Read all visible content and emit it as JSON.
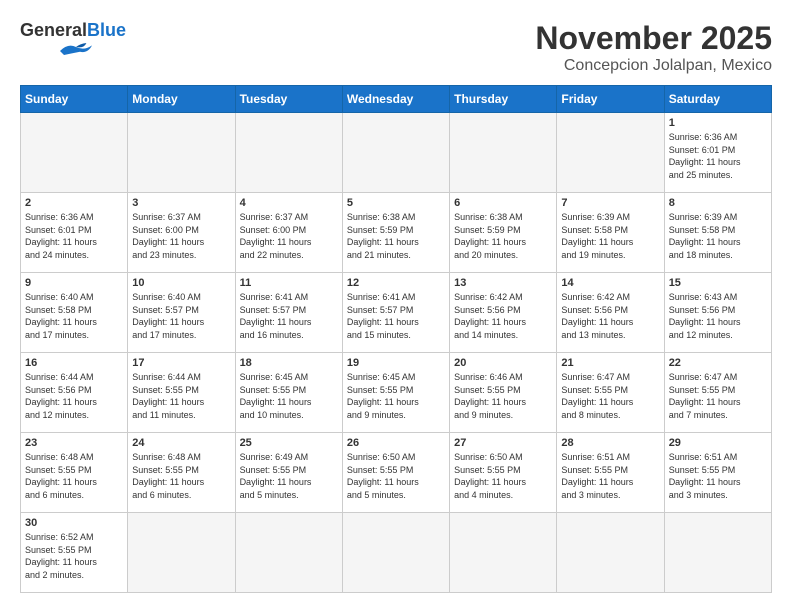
{
  "header": {
    "logo_general": "General",
    "logo_blue": "Blue",
    "month": "November 2025",
    "location": "Concepcion Jolalpan, Mexico"
  },
  "weekdays": [
    "Sunday",
    "Monday",
    "Tuesday",
    "Wednesday",
    "Thursday",
    "Friday",
    "Saturday"
  ],
  "weeks": [
    [
      {
        "day": "",
        "info": ""
      },
      {
        "day": "",
        "info": ""
      },
      {
        "day": "",
        "info": ""
      },
      {
        "day": "",
        "info": ""
      },
      {
        "day": "",
        "info": ""
      },
      {
        "day": "",
        "info": ""
      },
      {
        "day": "1",
        "info": "Sunrise: 6:36 AM\nSunset: 6:01 PM\nDaylight: 11 hours\nand 25 minutes."
      }
    ],
    [
      {
        "day": "2",
        "info": "Sunrise: 6:36 AM\nSunset: 6:01 PM\nDaylight: 11 hours\nand 24 minutes."
      },
      {
        "day": "3",
        "info": "Sunrise: 6:37 AM\nSunset: 6:00 PM\nDaylight: 11 hours\nand 23 minutes."
      },
      {
        "day": "4",
        "info": "Sunrise: 6:37 AM\nSunset: 6:00 PM\nDaylight: 11 hours\nand 22 minutes."
      },
      {
        "day": "5",
        "info": "Sunrise: 6:38 AM\nSunset: 5:59 PM\nDaylight: 11 hours\nand 21 minutes."
      },
      {
        "day": "6",
        "info": "Sunrise: 6:38 AM\nSunset: 5:59 PM\nDaylight: 11 hours\nand 20 minutes."
      },
      {
        "day": "7",
        "info": "Sunrise: 6:39 AM\nSunset: 5:58 PM\nDaylight: 11 hours\nand 19 minutes."
      },
      {
        "day": "8",
        "info": "Sunrise: 6:39 AM\nSunset: 5:58 PM\nDaylight: 11 hours\nand 18 minutes."
      }
    ],
    [
      {
        "day": "9",
        "info": "Sunrise: 6:40 AM\nSunset: 5:58 PM\nDaylight: 11 hours\nand 17 minutes."
      },
      {
        "day": "10",
        "info": "Sunrise: 6:40 AM\nSunset: 5:57 PM\nDaylight: 11 hours\nand 17 minutes."
      },
      {
        "day": "11",
        "info": "Sunrise: 6:41 AM\nSunset: 5:57 PM\nDaylight: 11 hours\nand 16 minutes."
      },
      {
        "day": "12",
        "info": "Sunrise: 6:41 AM\nSunset: 5:57 PM\nDaylight: 11 hours\nand 15 minutes."
      },
      {
        "day": "13",
        "info": "Sunrise: 6:42 AM\nSunset: 5:56 PM\nDaylight: 11 hours\nand 14 minutes."
      },
      {
        "day": "14",
        "info": "Sunrise: 6:42 AM\nSunset: 5:56 PM\nDaylight: 11 hours\nand 13 minutes."
      },
      {
        "day": "15",
        "info": "Sunrise: 6:43 AM\nSunset: 5:56 PM\nDaylight: 11 hours\nand 12 minutes."
      }
    ],
    [
      {
        "day": "16",
        "info": "Sunrise: 6:44 AM\nSunset: 5:56 PM\nDaylight: 11 hours\nand 12 minutes."
      },
      {
        "day": "17",
        "info": "Sunrise: 6:44 AM\nSunset: 5:55 PM\nDaylight: 11 hours\nand 11 minutes."
      },
      {
        "day": "18",
        "info": "Sunrise: 6:45 AM\nSunset: 5:55 PM\nDaylight: 11 hours\nand 10 minutes."
      },
      {
        "day": "19",
        "info": "Sunrise: 6:45 AM\nSunset: 5:55 PM\nDaylight: 11 hours\nand 9 minutes."
      },
      {
        "day": "20",
        "info": "Sunrise: 6:46 AM\nSunset: 5:55 PM\nDaylight: 11 hours\nand 9 minutes."
      },
      {
        "day": "21",
        "info": "Sunrise: 6:47 AM\nSunset: 5:55 PM\nDaylight: 11 hours\nand 8 minutes."
      },
      {
        "day": "22",
        "info": "Sunrise: 6:47 AM\nSunset: 5:55 PM\nDaylight: 11 hours\nand 7 minutes."
      }
    ],
    [
      {
        "day": "23",
        "info": "Sunrise: 6:48 AM\nSunset: 5:55 PM\nDaylight: 11 hours\nand 6 minutes."
      },
      {
        "day": "24",
        "info": "Sunrise: 6:48 AM\nSunset: 5:55 PM\nDaylight: 11 hours\nand 6 minutes."
      },
      {
        "day": "25",
        "info": "Sunrise: 6:49 AM\nSunset: 5:55 PM\nDaylight: 11 hours\nand 5 minutes."
      },
      {
        "day": "26",
        "info": "Sunrise: 6:50 AM\nSunset: 5:55 PM\nDaylight: 11 hours\nand 5 minutes."
      },
      {
        "day": "27",
        "info": "Sunrise: 6:50 AM\nSunset: 5:55 PM\nDaylight: 11 hours\nand 4 minutes."
      },
      {
        "day": "28",
        "info": "Sunrise: 6:51 AM\nSunset: 5:55 PM\nDaylight: 11 hours\nand 3 minutes."
      },
      {
        "day": "29",
        "info": "Sunrise: 6:51 AM\nSunset: 5:55 PM\nDaylight: 11 hours\nand 3 minutes."
      }
    ],
    [
      {
        "day": "30",
        "info": "Sunrise: 6:52 AM\nSunset: 5:55 PM\nDaylight: 11 hours\nand 2 minutes."
      },
      {
        "day": "",
        "info": ""
      },
      {
        "day": "",
        "info": ""
      },
      {
        "day": "",
        "info": ""
      },
      {
        "day": "",
        "info": ""
      },
      {
        "day": "",
        "info": ""
      },
      {
        "day": "",
        "info": ""
      }
    ]
  ]
}
